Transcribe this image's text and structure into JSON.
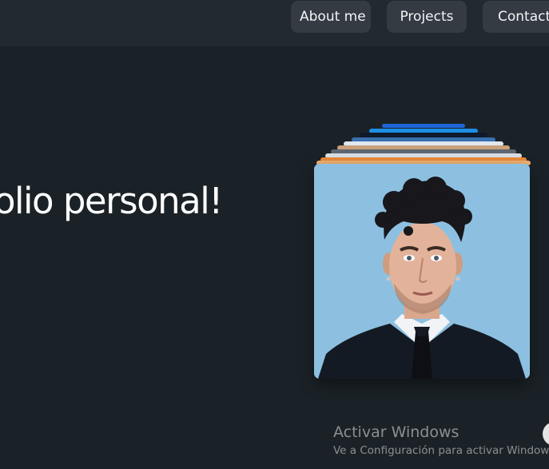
{
  "nav": {
    "about_label": "About me",
    "projects_label": "Projects",
    "contact_label": "Contact"
  },
  "hero": {
    "title": "olio personal!"
  },
  "watermark": {
    "title": "Activar Windows",
    "subtitle": "Ve a Configuración para activar Windows."
  },
  "colors": {
    "background": "#1b2227",
    "navbar": "#222a31",
    "nav_button": "#343b43",
    "portrait_background": "#8dc0e0"
  }
}
